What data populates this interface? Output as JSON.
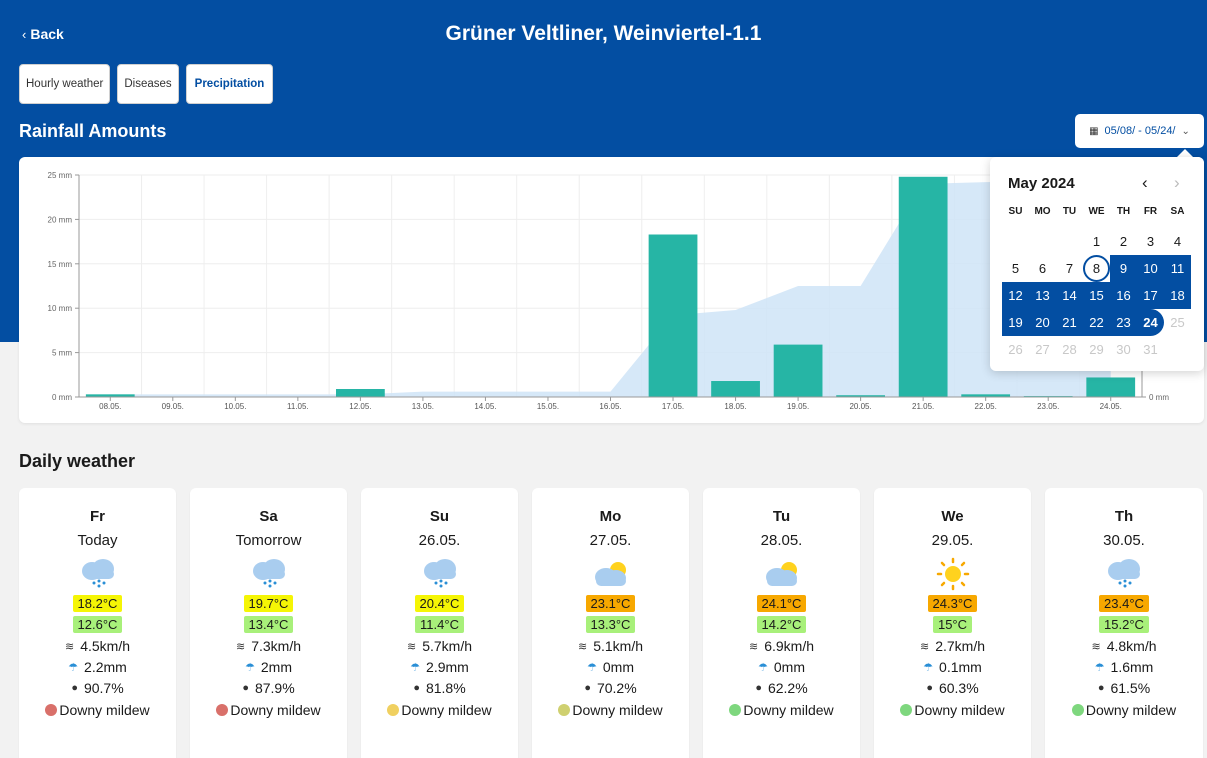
{
  "header": {
    "back_label": "Back",
    "title": "Grüner Veltliner, Weinviertel-1.1"
  },
  "tabs": [
    {
      "label": "Hourly weather",
      "active": false
    },
    {
      "label": "Diseases",
      "active": false
    },
    {
      "label": "Precipitation",
      "active": true
    }
  ],
  "rainfall": {
    "title": "Rainfall Amounts",
    "date_range": "05/08/ - 05/24/"
  },
  "colors": {
    "brand": "#034ea2",
    "bar": "#26b5a5",
    "area": "#cfe4f7",
    "tmax_yellow": "#f5f505",
    "tmax_orange": "#f7a800",
    "tmin_green": "#a8f07a",
    "risk_red": "#d9706a",
    "risk_yellow": "#f0d060",
    "risk_olive": "#cfd070",
    "risk_green": "#7ed77e"
  },
  "chart_data": {
    "type": "bar",
    "categories": [
      "08.05.",
      "09.05.",
      "10.05.",
      "11.05.",
      "12.05.",
      "13.05.",
      "14.05.",
      "15.05.",
      "16.05.",
      "17.05.",
      "18.05.",
      "19.05.",
      "20.05.",
      "21.05.",
      "22.05.",
      "23.05.",
      "24.05."
    ],
    "series": [
      {
        "values": [
          0.3,
          0,
          0,
          0,
          0.9,
          0,
          0,
          0,
          0,
          18.3,
          1.8,
          5.9,
          0.2,
          24.8,
          0.3,
          0.1,
          2.2
        ]
      },
      {
        "type": "area",
        "values": [
          0.3,
          0.3,
          0.3,
          0.3,
          0.3,
          0.6,
          0.6,
          0.6,
          0.6,
          9.2,
          9.8,
          12.5,
          12.5,
          24.0,
          24.2,
          24.3,
          24.5
        ]
      }
    ],
    "y_ticks": [
      "0 mm",
      "5 mm",
      "10 mm",
      "15 mm",
      "20 mm",
      "25 mm"
    ],
    "right_tick": "0 mm",
    "ylim": [
      0,
      25
    ],
    "grid": true
  },
  "calendar": {
    "month_label": "May 2024",
    "weekdays": [
      "SU",
      "MO",
      "TU",
      "WE",
      "TH",
      "FR",
      "SA"
    ],
    "leading_blanks": 3,
    "days": [
      "1",
      "2",
      "3",
      "4",
      "5",
      "6",
      "7",
      "8",
      "9",
      "10",
      "11",
      "12",
      "13",
      "14",
      "15",
      "16",
      "17",
      "18",
      "19",
      "20",
      "21",
      "22",
      "23",
      "24",
      "25",
      "26",
      "27",
      "28",
      "29",
      "30",
      "31"
    ],
    "range_start": 8,
    "range_end": 24,
    "last_enabled": 24
  },
  "daily": {
    "title": "Daily weather",
    "days": [
      {
        "name": "Fr",
        "sub": "Today",
        "icon": "rain-cloud-icon",
        "tmax": "18.2°C",
        "tmax_color": "#f5f505",
        "tmin": "12.6°C",
        "wind": "4.5km/h",
        "precip": "2.2mm",
        "humidity": "90.7%",
        "disease": "Downy mildew",
        "risk_color": "#d9706a"
      },
      {
        "name": "Sa",
        "sub": "Tomorrow",
        "icon": "rain-cloud-icon",
        "tmax": "19.7°C",
        "tmax_color": "#f5f505",
        "tmin": "13.4°C",
        "wind": "7.3km/h",
        "precip": "2mm",
        "humidity": "87.9%",
        "disease": "Downy mildew",
        "risk_color": "#d9706a"
      },
      {
        "name": "Su",
        "sub": "26.05.",
        "icon": "rain-cloud-icon",
        "tmax": "20.4°C",
        "tmax_color": "#f5f505",
        "tmin": "11.4°C",
        "wind": "5.7km/h",
        "precip": "2.9mm",
        "humidity": "81.8%",
        "disease": "Downy mildew",
        "risk_color": "#f0d060"
      },
      {
        "name": "Mo",
        "sub": "27.05.",
        "icon": "partly-cloudy-icon",
        "tmax": "23.1°C",
        "tmax_color": "#f7a800",
        "tmin": "13.3°C",
        "wind": "5.1km/h",
        "precip": "0mm",
        "humidity": "70.2%",
        "disease": "Downy mildew",
        "risk_color": "#cfd070"
      },
      {
        "name": "Tu",
        "sub": "28.05.",
        "icon": "partly-cloudy-icon",
        "tmax": "24.1°C",
        "tmax_color": "#f7a800",
        "tmin": "14.2°C",
        "wind": "6.9km/h",
        "precip": "0mm",
        "humidity": "62.2%",
        "disease": "Downy mildew",
        "risk_color": "#7ed77e"
      },
      {
        "name": "We",
        "sub": "29.05.",
        "icon": "sun-icon",
        "tmax": "24.3°C",
        "tmax_color": "#f7a800",
        "tmin": "15°C",
        "wind": "2.7km/h",
        "precip": "0.1mm",
        "humidity": "60.3%",
        "disease": "Downy mildew",
        "risk_color": "#7ed77e"
      },
      {
        "name": "Th",
        "sub": "30.05.",
        "icon": "rain-cloud-icon",
        "tmax": "23.4°C",
        "tmax_color": "#f7a800",
        "tmin": "15.2°C",
        "wind": "4.8km/h",
        "precip": "1.6mm",
        "humidity": "61.5%",
        "disease": "Downy mildew",
        "risk_color": "#7ed77e"
      }
    ]
  }
}
